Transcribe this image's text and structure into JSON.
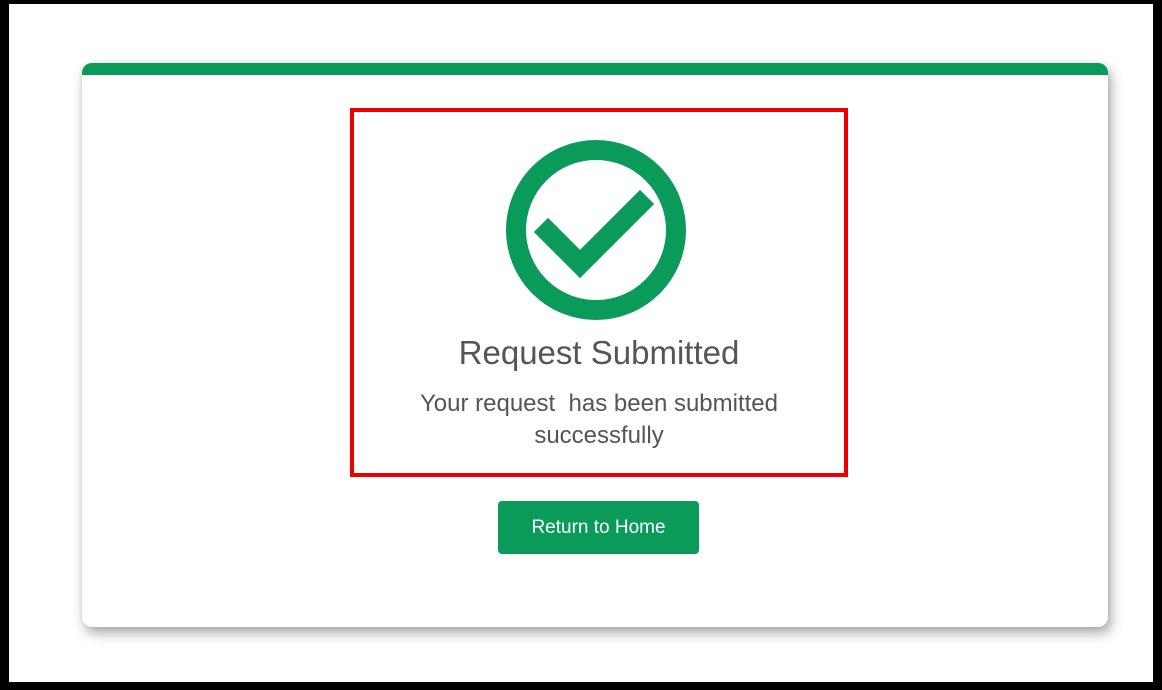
{
  "colors": {
    "brand_green": "#0a9b5a",
    "highlight_red": "#ee0000",
    "text_gray": "#555555"
  },
  "status": {
    "icon": "check-circle-icon",
    "title": "Request Submitted",
    "message": "Your request  has been submitted successfully"
  },
  "actions": {
    "return_home_label": "Return to Home"
  }
}
